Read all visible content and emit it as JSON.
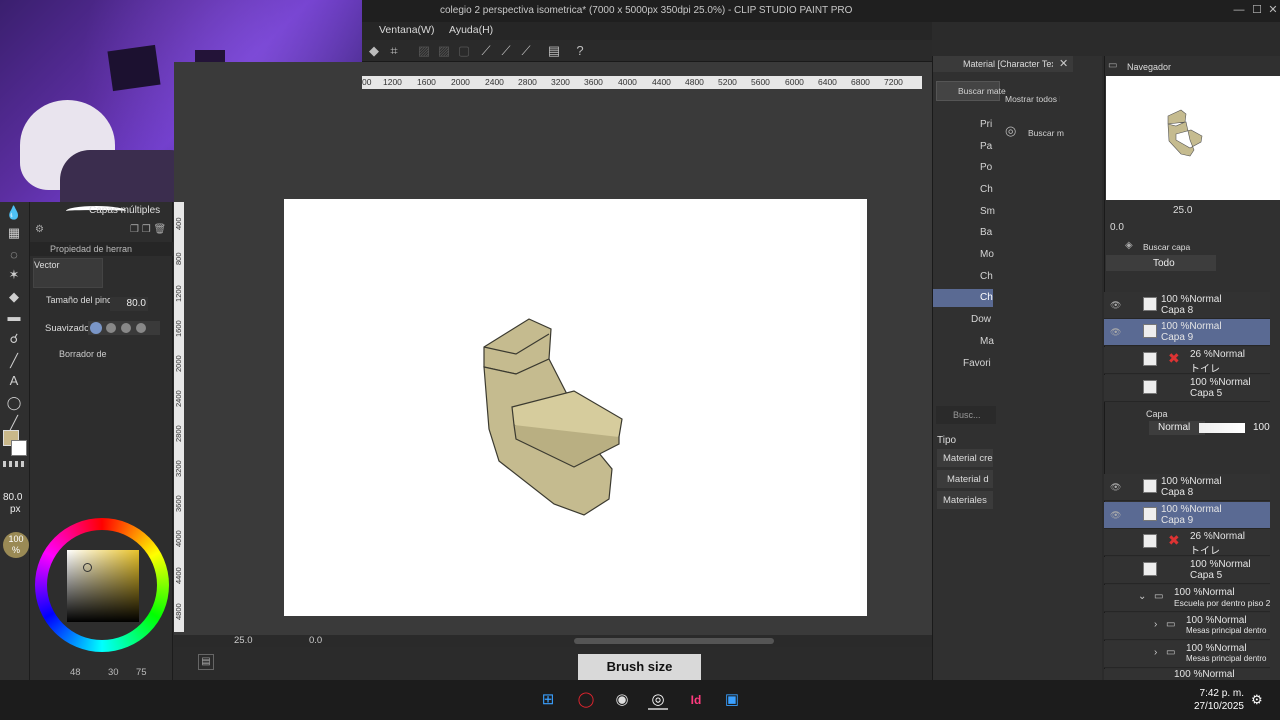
{
  "window": {
    "title": "colegio 2 perspectiva isometrica* (7000 x 5000px 350dpi 25.0%) - CLIP STUDIO PAINT PRO",
    "minimize": "—",
    "maximize": "☐",
    "close": "✕"
  },
  "menu": {
    "items": [
      "Ventana(W)",
      "Ayuda(H)"
    ]
  },
  "ruler": {
    "h_ticks": [
      "00",
      "1200",
      "1600",
      "2000",
      "2400",
      "2800",
      "3200",
      "3600",
      "4000",
      "4400",
      "4800",
      "5200",
      "5600",
      "6000",
      "6400",
      "6800",
      "7200"
    ],
    "v_ticks": [
      "400",
      "800",
      "1200",
      "1600",
      "2000",
      "2400",
      "2800",
      "3200",
      "3600",
      "4000",
      "4400",
      "4800"
    ]
  },
  "tool_panel": {
    "subtool_name": "Capas múltiples",
    "prop_header": "Propiedad de herran",
    "vector_label": "Vector",
    "brush_size_label": "Tamaño del pince",
    "brush_size_value": "80.0",
    "smoothing_label": "Suavizado",
    "eraser_label": "Borrador de",
    "size_readout": "80.0",
    "size_unit": "px",
    "opacity_readout": "100",
    "opacity_unit": "%",
    "bottom_values": [
      "48",
      "30",
      "75"
    ],
    "main_color": "#c9b88a"
  },
  "canvas_status": {
    "zoom": "25.0",
    "angle": "0.0"
  },
  "material_panel": {
    "tab_title": "Material [Character Text",
    "search_button": "Buscar mate",
    "show_all": "Mostrar todos lo",
    "search_button2": "Buscar m",
    "tree_items": [
      "Pri",
      "Pa",
      "Po",
      "Ch",
      "Sm",
      "Ba",
      "Mo",
      "Ch",
      "Ch",
      "Dow",
      "Ma",
      "Favori"
    ],
    "search_placeholder": "Busc...",
    "type_label": "Tipo",
    "type_options": [
      "Material cre",
      "Material d",
      "Materiales"
    ]
  },
  "navigator": {
    "title": "Navegador",
    "zoom": "25.0",
    "angle": "0.0"
  },
  "layer_search": {
    "title": "Buscar capa",
    "filter": "Todo",
    "rows": [
      {
        "pct": "100 %Normal",
        "name": "Capa 8",
        "selected": false
      },
      {
        "pct": "100 %Normal",
        "name": "Capa 9",
        "selected": true
      },
      {
        "pct": "26 %Normal",
        "name": "トイレ",
        "selected": false
      },
      {
        "pct": "100 %Normal",
        "name": "Capa 5",
        "selected": false
      }
    ]
  },
  "layers": {
    "title": "Capa",
    "blend_mode": "Normal",
    "opacity": "100",
    "rows": [
      {
        "pct": "100 %Normal",
        "name": "Capa 8",
        "selected": false
      },
      {
        "pct": "100 %Normal",
        "name": "Capa 9",
        "selected": true
      },
      {
        "pct": "26 %Normal",
        "name": "トイレ",
        "selected": false
      },
      {
        "pct": "100 %Normal",
        "name": "Capa 5",
        "selected": false
      },
      {
        "pct": "100 %Normal",
        "name": "Escuela por dentro piso 2",
        "selected": false
      },
      {
        "pct": "100 %Normal",
        "name": "Mesas principal dentro",
        "selected": false
      },
      {
        "pct": "100 %Normal",
        "name": "Mesas principal dentro",
        "selected": false
      },
      {
        "pct": "100 %Normal",
        "name": "",
        "selected": false
      }
    ]
  },
  "overlay": {
    "brush_size_label": "Brush size"
  },
  "taskbar": {
    "time": "7:42 p. m.",
    "date": "27/10/2025"
  }
}
